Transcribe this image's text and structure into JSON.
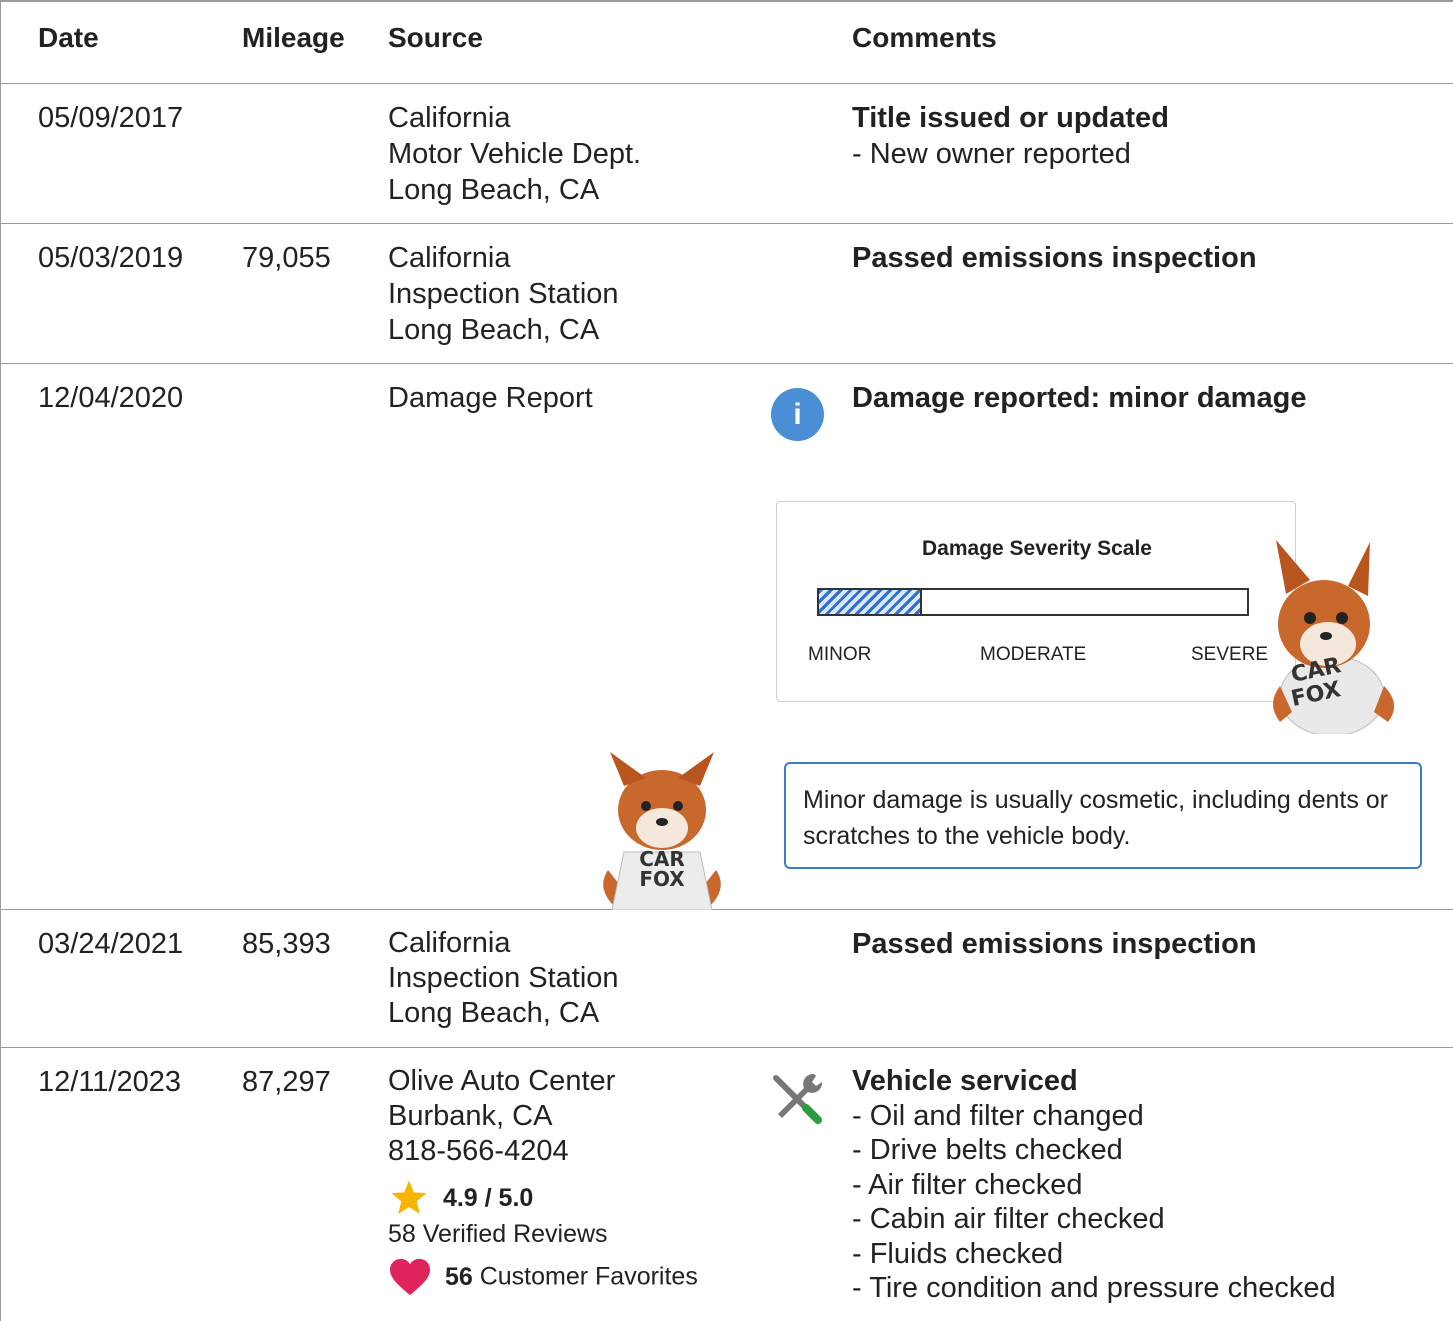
{
  "header": {
    "date": "Date",
    "mileage": "Mileage",
    "source": "Source",
    "comments": "Comments"
  },
  "records": [
    {
      "date": "05/09/2017",
      "mileage": "",
      "source": [
        "California",
        "Motor Vehicle Dept.",
        "Long Beach, CA"
      ],
      "title": "Title issued or updated",
      "details": [
        "- New owner reported"
      ]
    },
    {
      "date": "05/03/2019",
      "mileage": "79,055",
      "source": [
        "California",
        "Inspection Station",
        "Long Beach, CA"
      ],
      "title": "Passed emissions inspection",
      "details": []
    },
    {
      "date": "12/04/2020",
      "mileage": "",
      "source": [
        "Damage Report"
      ],
      "title": "Damage reported: minor damage",
      "details": [],
      "info_icon": "info-icon",
      "severity": {
        "title": "Damage Severity Scale",
        "labels": [
          "MINOR",
          "MODERATE",
          "SEVERE"
        ],
        "level": 0.24
      },
      "tip": "Minor damage is usually cosmetic, including dents or scratches to the vehicle body.",
      "fox_shirt": [
        "CAR",
        "FOX"
      ]
    },
    {
      "date": "03/24/2021",
      "mileage": "85,393",
      "source": [
        "California",
        "Inspection Station",
        "Long Beach, CA"
      ],
      "title": "Passed emissions inspection",
      "details": []
    },
    {
      "date": "12/11/2023",
      "mileage": "87,297",
      "source": [
        "Olive Auto Center",
        "Burbank, CA",
        "818-566-4204"
      ],
      "rating": "4.9 / 5.0",
      "reviews": "58 Verified Reviews",
      "favorites_count": "56",
      "favorites_label": "Customer Favorites",
      "title": "Vehicle serviced",
      "service_icon": "wrench-screwdriver-icon",
      "details": [
        "- Oil and filter changed",
        "- Drive belts checked",
        "- Air filter checked",
        "- Cabin air filter checked",
        "- Fluids checked",
        "- Tire condition and pressure checked"
      ]
    }
  ],
  "colors": {
    "accent_blue": "#3d7dc8",
    "info_blue": "#4a8fd6",
    "star_yellow": "#f7b500",
    "heart_pink": "#e0255e",
    "divider": "#9a9a9a"
  }
}
